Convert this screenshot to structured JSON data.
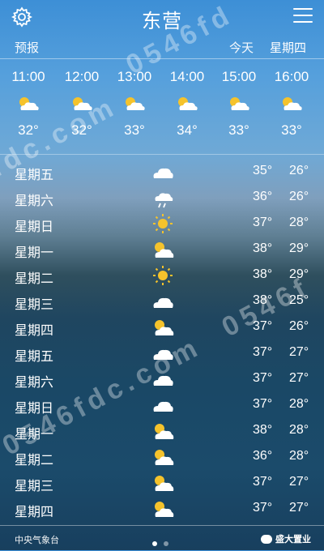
{
  "header": {
    "city": "东营",
    "settings_icon": "gear-icon",
    "menu_icon": "menu-icon"
  },
  "subheader": {
    "forecast_label": "预报",
    "today_label": "今天",
    "today_day": "星期四"
  },
  "hourly": [
    {
      "time": "11:00",
      "icon": "partly-sunny-icon",
      "temp": "32°"
    },
    {
      "time": "12:00",
      "icon": "partly-sunny-icon",
      "temp": "32°"
    },
    {
      "time": "13:00",
      "icon": "partly-sunny-icon",
      "temp": "33°"
    },
    {
      "time": "14:00",
      "icon": "partly-sunny-icon",
      "temp": "34°"
    },
    {
      "time": "15:00",
      "icon": "partly-sunny-icon",
      "temp": "33°"
    },
    {
      "time": "16:00",
      "icon": "partly-sunny-icon",
      "temp": "33°"
    }
  ],
  "daily": [
    {
      "day": "星期五",
      "icon": "cloud-icon",
      "high": "35°",
      "low": "26°"
    },
    {
      "day": "星期六",
      "icon": "cloud-rain-icon",
      "high": "36°",
      "low": "26°"
    },
    {
      "day": "星期日",
      "icon": "sun-icon",
      "high": "37°",
      "low": "28°"
    },
    {
      "day": "星期一",
      "icon": "partly-sunny-icon",
      "high": "38°",
      "low": "29°"
    },
    {
      "day": "星期二",
      "icon": "sun-icon",
      "high": "38°",
      "low": "29°"
    },
    {
      "day": "星期三",
      "icon": "cloud-icon",
      "high": "38°",
      "low": "25°"
    },
    {
      "day": "星期四",
      "icon": "partly-sunny-icon",
      "high": "37°",
      "low": "26°"
    },
    {
      "day": "星期五",
      "icon": "cloud-icon",
      "high": "37°",
      "low": "27°"
    },
    {
      "day": "星期六",
      "icon": "cloud-icon",
      "high": "37°",
      "low": "27°"
    },
    {
      "day": "星期日",
      "icon": "cloud-icon",
      "high": "37°",
      "low": "28°"
    },
    {
      "day": "星期一",
      "icon": "partly-sunny-icon",
      "high": "38°",
      "low": "28°"
    },
    {
      "day": "星期二",
      "icon": "partly-sunny-icon",
      "high": "36°",
      "low": "28°"
    },
    {
      "day": "星期三",
      "icon": "partly-sunny-icon",
      "high": "37°",
      "low": "27°"
    },
    {
      "day": "星期四",
      "icon": "partly-sunny-icon",
      "high": "37°",
      "low": "27°"
    }
  ],
  "footer": {
    "source": "中央气象台",
    "brand": "盛大置业",
    "page_dots": 2,
    "active_dot": 1
  },
  "watermarks": [
    "0546fd",
    "fdc.com",
    "0546f",
    "0546fdc.com"
  ]
}
